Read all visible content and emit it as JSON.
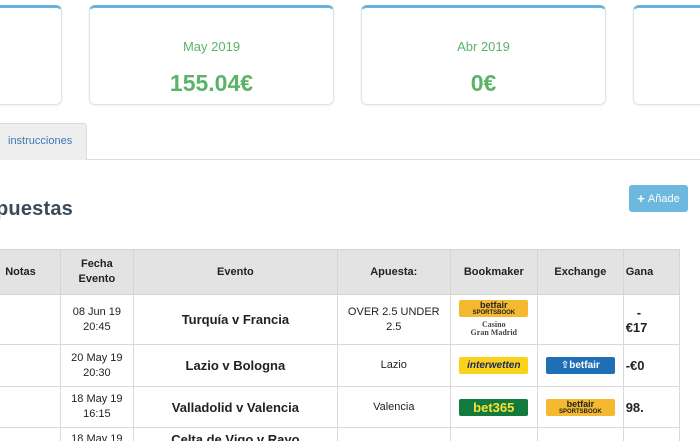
{
  "cards": [
    {
      "month": "",
      "amount": ""
    },
    {
      "month": "May 2019",
      "amount": "155.04€"
    },
    {
      "month": "Abr 2019",
      "amount": "0€"
    },
    {
      "month": "",
      "amount": ""
    }
  ],
  "tabs": [
    {
      "label": "instrucciones"
    }
  ],
  "section": {
    "title": "puestas",
    "add_label": "Añade"
  },
  "table": {
    "headers": {
      "notas": "Notas",
      "fecha_1": "Fecha",
      "fecha_2": "Evento",
      "evento": "Evento",
      "apuesta": "Apuesta:",
      "bookmaker": "Bookmaker",
      "exchange": "Exchange",
      "ganancia": "Gana"
    },
    "rows": [
      {
        "date": "08 Jun 19",
        "time": "20:45",
        "event": "Turquía v Francia",
        "bet_1": "OVER 2.5 UNDER",
        "bet_2": "2.5",
        "bookmaker": "betfair sportsbook + casino gran madrid",
        "exchange": "",
        "profit_1": "-",
        "profit_2": "€17"
      },
      {
        "date": "20 May 19",
        "time": "20:30",
        "event": "Lazio v Bologna",
        "bet_1": "Lazio",
        "bet_2": "",
        "bookmaker": "interwetten",
        "exchange": "betfair",
        "profit_1": "-€0",
        "profit_2": ""
      },
      {
        "date": "18 May 19",
        "time": "16:15",
        "event": "Valladolid v Valencia",
        "bet_1": "Valencia",
        "bet_2": "",
        "bookmaker": "bet365",
        "exchange": "betfair sportsbook",
        "profit_1": "98.",
        "profit_2": ""
      },
      {
        "date": "18 May 19",
        "time": "",
        "event": "Celta de Vigo v Rayo",
        "bet_1": "",
        "bet_2": "",
        "bookmaker": "",
        "exchange": "",
        "profit_1": "",
        "profit_2": ""
      }
    ]
  },
  "logos": {
    "betfair_sportsbook_top": "betfair",
    "betfair_sportsbook_sub": "SPORTSBOOK",
    "casino_1": "Casino",
    "casino_2": "Gran Madrid",
    "interwetten": "interwetten",
    "bet365": "bet365",
    "betfair_ex": "betfair"
  },
  "colors": {
    "accent": "#6ab4dc",
    "positive": "#5bb36a",
    "negative": "#d9383a",
    "button": "#6cb8de"
  }
}
